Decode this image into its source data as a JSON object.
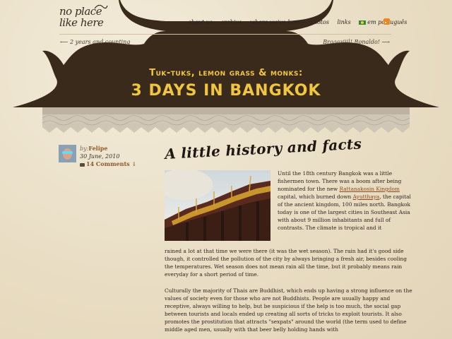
{
  "site": {
    "logo_line1": "no place",
    "logo_line2": "like here"
  },
  "nav": {
    "items": [
      "about us",
      "archive",
      "where we've been",
      "photos",
      "links"
    ],
    "language": "em português"
  },
  "pagination": {
    "prev": "2 years and counting",
    "next": "Braaaziiil! Ronaldo!"
  },
  "banner": {
    "subtitle": "Tuk-tuks, lemon grass & monks:",
    "title": "3 DAYS IN BANGKOK"
  },
  "post": {
    "by_label": "by:",
    "author": "Felipe",
    "date": "30 June, 2010",
    "comments": "14 Comments ↓",
    "heading": "A little history and facts",
    "p1_a": "Until the 18th century Bangkok was a little fishermen town. There was a boom after being nominated for the new ",
    "p1_link1": "Rattanakosin Kingdom",
    "p1_b": " capital, which burned down ",
    "p1_link2": "Ayutthaya",
    "p1_c": ", the capital of the ancient kingdom, 100 miles north. Bangkok today is one of the largest cities in Southeast Asia with about 9 million inhabitants and full of contrasts. The climate is tropical and it",
    "p2": "rained a lot at that time we were there (it was the wet season). The rain had it's good side though, it controlled the pollution of the city by always bringing a fresh air, besides cooling the temperatures. Wet season does not mean rain all the time, but it probably means rain everyday for a short period of time.",
    "p3": "Culturally the majority of Thais are Buddhist, which ends up having a strong influence on the values of society even for those who are not Buddhists. People are usually happy and receptive, always willing to help, but be suspicious if the help is too much, the social gap between tourists and locals ended up creating all sorts of tricks to exploit tourists. It also promotes the prostitution that attracts \"sexpats\" around the world (the term used to define middle aged men, usually with that beer belly holding hands with"
  },
  "colors": {
    "background": "#ece3cf",
    "banner_text": "#f0c640",
    "roof": "#3a2a1c",
    "link": "#8b4a1e"
  },
  "icons": [
    "prev-arrow-icon",
    "next-arrow-icon",
    "flag-icon",
    "rss-icon",
    "comment-icon"
  ]
}
